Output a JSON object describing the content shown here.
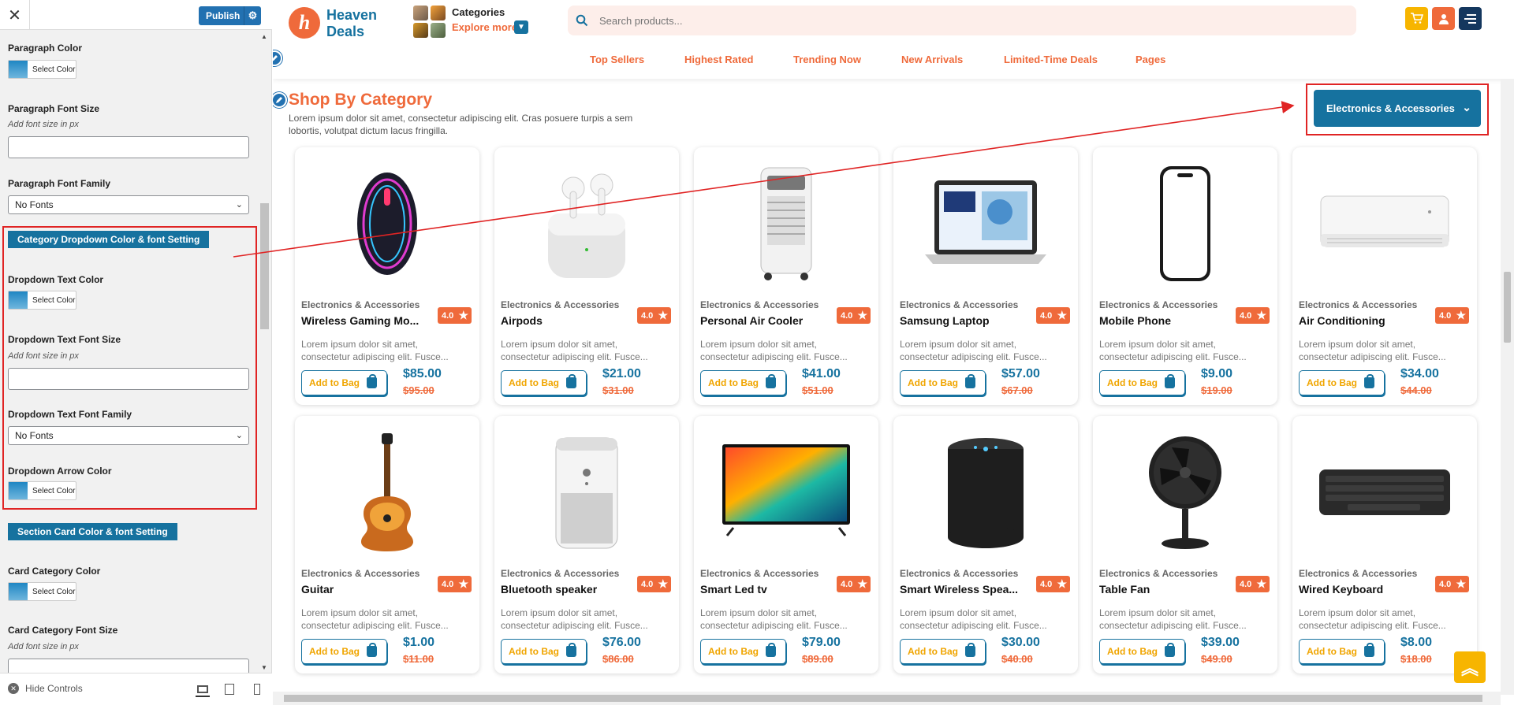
{
  "customizer": {
    "close_label": "✕",
    "publish_label": "Publish",
    "controls": [
      {
        "label": "Paragraph Color",
        "type": "color",
        "button_label": "Select Color"
      },
      {
        "label": "Paragraph Font Size",
        "type": "text",
        "description": "Add font size in px",
        "value": ""
      },
      {
        "label": "Paragraph Font Family",
        "type": "select",
        "value": "No Fonts"
      },
      {
        "label": "Category Dropdown Color & font Setting",
        "type": "section"
      },
      {
        "label": "Dropdown Text Color",
        "type": "color",
        "button_label": "Select Color"
      },
      {
        "label": "Dropdown Text Font Size",
        "type": "text",
        "description": "Add font size in px",
        "value": ""
      },
      {
        "label": "Dropdown Text Font Family",
        "type": "select",
        "value": "No Fonts"
      },
      {
        "label": "Dropdown Arrow Color",
        "type": "color",
        "button_label": "Select Color"
      },
      {
        "label": "Section Card Color & font Setting",
        "type": "section"
      },
      {
        "label": "Card Category Color",
        "type": "color",
        "button_label": "Select Color"
      },
      {
        "label": "Card Category Font Size",
        "type": "text",
        "description": "Add font size in px",
        "value": ""
      }
    ],
    "footer": {
      "hide_controls_label": "Hide Controls"
    }
  },
  "site": {
    "logo": {
      "letter": "h",
      "line1": "Heaven",
      "line2": "Deals"
    },
    "categories": {
      "title": "Categories",
      "explore": "Explore more"
    },
    "search": {
      "placeholder": "Search products..."
    },
    "nav": [
      "Top Sellers",
      "Highest Rated",
      "Trending Now",
      "New Arrivals",
      "Limited-Time Deals",
      "Pages"
    ],
    "section": {
      "title": "Shop By Category",
      "description": "Lorem ipsum dolor sit amet, consectetur adipiscing elit. Cras posuere turpis a sem lobortis, volutpat dictum lacus fringilla.",
      "dropdown_value": "Electronics & Accessories"
    },
    "products": [
      {
        "category": "Electronics & Accessories",
        "title": "Wireless Gaming Mo...",
        "rating": "4.0",
        "description": "Lorem ipsum dolor sit amet, consectetur adipiscing elit. Fusce...",
        "add_label": "Add to Bag",
        "price": "$85.00",
        "old_price": "$95.00",
        "image": "gaming-mouse"
      },
      {
        "category": "Electronics & Accessories",
        "title": "Airpods",
        "rating": "4.0",
        "description": "Lorem ipsum dolor sit amet, consectetur adipiscing elit. Fusce...",
        "add_label": "Add to Bag",
        "price": "$21.00",
        "old_price": "$31.00",
        "image": "airpods"
      },
      {
        "category": "Electronics & Accessories",
        "title": "Personal Air Cooler",
        "rating": "4.0",
        "description": "Lorem ipsum dolor sit amet, consectetur adipiscing elit. Fusce...",
        "add_label": "Add to Bag",
        "price": "$41.00",
        "old_price": "$51.00",
        "image": "air-cooler"
      },
      {
        "category": "Electronics & Accessories",
        "title": "Samsung Laptop",
        "rating": "4.0",
        "description": "Lorem ipsum dolor sit amet, consectetur adipiscing elit. Fusce...",
        "add_label": "Add to Bag",
        "price": "$57.00",
        "old_price": "$67.00",
        "image": "laptop"
      },
      {
        "category": "Electronics & Accessories",
        "title": "Mobile Phone",
        "rating": "4.0",
        "description": "Lorem ipsum dolor sit amet, consectetur adipiscing elit. Fusce...",
        "add_label": "Add to Bag",
        "price": "$9.00",
        "old_price": "$19.00",
        "image": "phone"
      },
      {
        "category": "Electronics & Accessories",
        "title": "Air Conditioning",
        "rating": "4.0",
        "description": "Lorem ipsum dolor sit amet, consectetur adipiscing elit. Fusce...",
        "add_label": "Add to Bag",
        "price": "$34.00",
        "old_price": "$44.00",
        "image": "air-conditioner"
      },
      {
        "category": "Electronics & Accessories",
        "title": "Guitar",
        "rating": "4.0",
        "description": "Lorem ipsum dolor sit amet, consectetur adipiscing elit. Fusce...",
        "add_label": "Add to Bag",
        "price": "$1.00",
        "old_price": "$11.00",
        "image": "guitar"
      },
      {
        "category": "Electronics & Accessories",
        "title": "Bluetooth speaker",
        "rating": "4.0",
        "description": "Lorem ipsum dolor sit amet, consectetur adipiscing elit. Fusce...",
        "add_label": "Add to Bag",
        "price": "$76.00",
        "old_price": "$86.00",
        "image": "bluetooth-speaker"
      },
      {
        "category": "Electronics & Accessories",
        "title": "Smart Led tv",
        "rating": "4.0",
        "description": "Lorem ipsum dolor sit amet, consectetur adipiscing elit. Fusce...",
        "add_label": "Add to Bag",
        "price": "$79.00",
        "old_price": "$89.00",
        "image": "led-tv"
      },
      {
        "category": "Electronics & Accessories",
        "title": "Smart Wireless Spea...",
        "rating": "4.0",
        "description": "Lorem ipsum dolor sit amet, consectetur adipiscing elit. Fusce...",
        "add_label": "Add to Bag",
        "price": "$30.00",
        "old_price": "$40.00",
        "image": "smart-speaker"
      },
      {
        "category": "Electronics & Accessories",
        "title": "Table Fan",
        "rating": "4.0",
        "description": "Lorem ipsum dolor sit amet, consectetur adipiscing elit. Fusce...",
        "add_label": "Add to Bag",
        "price": "$39.00",
        "old_price": "$49.00",
        "image": "table-fan"
      },
      {
        "category": "Electronics & Accessories",
        "title": "Wired Keyboard",
        "rating": "4.0",
        "description": "Lorem ipsum dolor sit amet, consectetur adipiscing elit. Fusce...",
        "add_label": "Add to Bag",
        "price": "$8.00",
        "old_price": "$18.00",
        "image": "keyboard"
      }
    ]
  },
  "colors": {
    "brand_orange": "#ef6a3b",
    "brand_teal": "#16729f",
    "publish_blue": "#2271b1",
    "highlight_red": "#e02424",
    "scroll_top_yellow": "#f7b500"
  }
}
